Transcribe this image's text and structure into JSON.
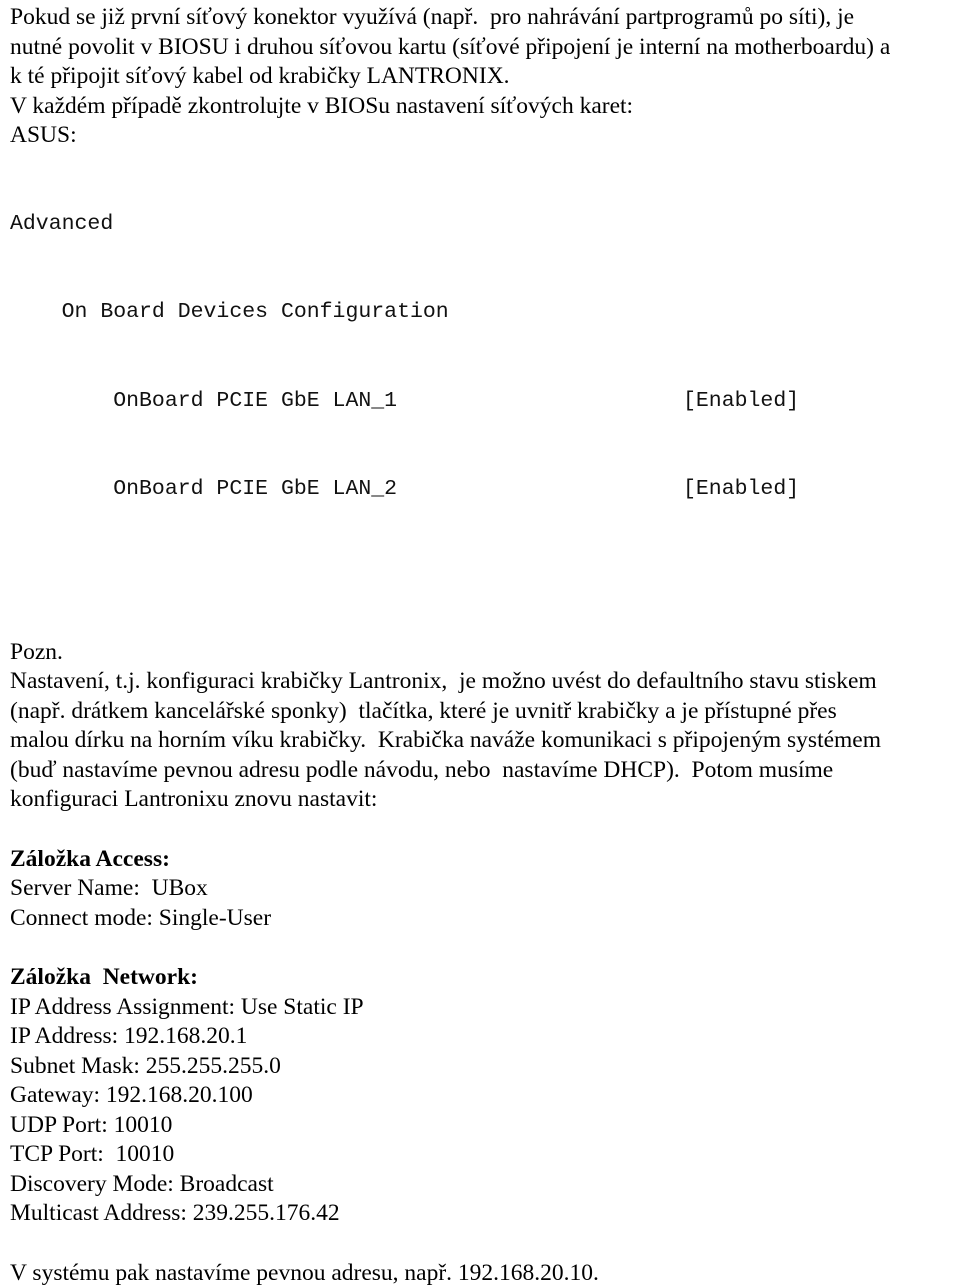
{
  "document": {
    "language": "cs",
    "background_color": "#ffffff",
    "text_color": "#000000"
  },
  "intro_paragraph": {
    "lines": [
      "Pokud se již první síťový konektor využívá (např.  pro nahrávání partprogramů po síti), je",
      "nutné povolit v BIOSU i druhou síťovou kartu (síťové připojení je interní na motherboardu) a",
      "k té připojit síťový kabel od krabičky LANTRONIX.",
      "V každém případě zkontrolujte v BIOSu nastavení síťových karet:"
    ]
  },
  "bios": {
    "vendor_label": "ASUS:",
    "menu": "Advanced",
    "submenu": "On Board Devices Configuration",
    "items": [
      {
        "label": "OnBoard PCIE GbE LAN_1",
        "value": "[Enabled]"
      },
      {
        "label": "OnBoard PCIE GbE LAN_2",
        "value": "[Enabled]"
      }
    ]
  },
  "note": {
    "title": "Pozn.",
    "lines": [
      "Nastavení, t.j. konfiguraci krabičky Lantronix,  je možno uvést do defaultního stavu stiskem",
      "(např. drátkem kancelářské sponky)  tlačítka, které je uvnitř krabičky a je přístupné přes",
      "malou dírku na horním víku krabičky.  Krabička naváže komunikaci s připojeným systémem",
      "(buď nastavíme pevnou adresu podle návodu, nebo  nastavíme DHCP).  Potom musíme",
      "konfiguraci Lantronixu znovu nastavit:"
    ]
  },
  "access_tab": {
    "heading": "Záložka Access:",
    "settings": [
      "Server Name:  UBox",
      "Connect mode: Single-User"
    ]
  },
  "network_tab": {
    "heading": "Záložka  Network:",
    "settings": [
      "IP Address Assignment: Use Static IP",
      "IP Address: 192.168.20.1",
      "Subnet Mask: 255.255.255.0",
      "Gateway: 192.168.20.100",
      "UDP Port: 10010",
      "TCP Port:  10010",
      "Discovery Mode: Broadcast",
      "Multicast Address: 239.255.176.42"
    ]
  },
  "closing_paragraph": {
    "text": "V systému pak nastavíme pevnou adresu, např. 192.168.20.10."
  }
}
